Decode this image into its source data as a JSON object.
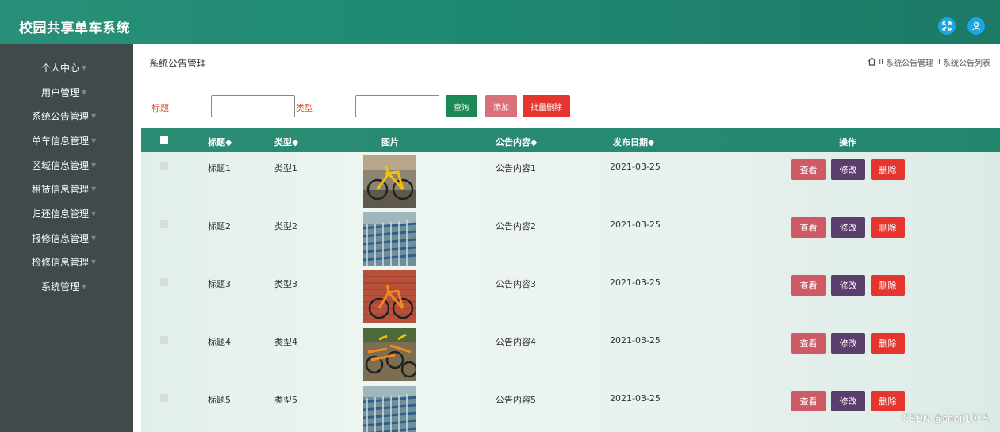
{
  "app": {
    "title": "校园共享单车系统"
  },
  "header_icons": [
    "fullscreen-icon",
    "user-icon"
  ],
  "sidebar": {
    "items": [
      {
        "label": "个人中心"
      },
      {
        "label": "用户管理"
      },
      {
        "label": "系统公告管理"
      },
      {
        "label": "单车信息管理"
      },
      {
        "label": "区域信息管理"
      },
      {
        "label": "租赁信息管理"
      },
      {
        "label": "归还信息管理"
      },
      {
        "label": "报修信息管理"
      },
      {
        "label": "检修信息管理"
      },
      {
        "label": "系统管理"
      }
    ]
  },
  "page": {
    "title": "系统公告管理",
    "breadcrumb": {
      "sep": "II",
      "level1": "系统公告管理",
      "level2": "系统公告列表"
    }
  },
  "search": {
    "title_label": "标题",
    "title_value": "",
    "type_label": "类型",
    "type_value": "",
    "query_button": "查询",
    "add_button": "添加",
    "batch_delete_button": "批量删除"
  },
  "table": {
    "headers": {
      "title": "标题◆",
      "type": "类型◆",
      "image": "图片",
      "content": "公告内容◆",
      "date": "发布日期◆",
      "actions": "操作"
    },
    "rows": [
      {
        "title": "标题1",
        "type": "类型1",
        "image": "yellow-bike",
        "content": "公告内容1",
        "date": "2021-03-25"
      },
      {
        "title": "标题2",
        "type": "类型2",
        "image": "bike-rows",
        "content": "公告内容2",
        "date": "2021-03-25"
      },
      {
        "title": "标题3",
        "type": "类型3",
        "image": "orange-bike-brick",
        "content": "公告内容3",
        "date": "2021-03-25"
      },
      {
        "title": "标题4",
        "type": "类型4",
        "image": "orange-bikes-yard",
        "content": "公告内容4",
        "date": "2021-03-25"
      },
      {
        "title": "标题5",
        "type": "类型5",
        "image": "bike-rows",
        "content": "公告内容5",
        "date": "2021-03-25"
      }
    ],
    "row_actions": {
      "view": "查看",
      "edit": "修改",
      "delete": "删除"
    }
  },
  "colors": {
    "header_teal": "#22876f",
    "sidebar_bg": "#414a4a",
    "query_green": "#1b8a52",
    "add_pink": "#d9707a",
    "delete_red": "#e5352f",
    "edit_purple": "#5a3e6c",
    "view_rose": "#cd5a64"
  },
  "watermark": "CSDN @sheji1015"
}
